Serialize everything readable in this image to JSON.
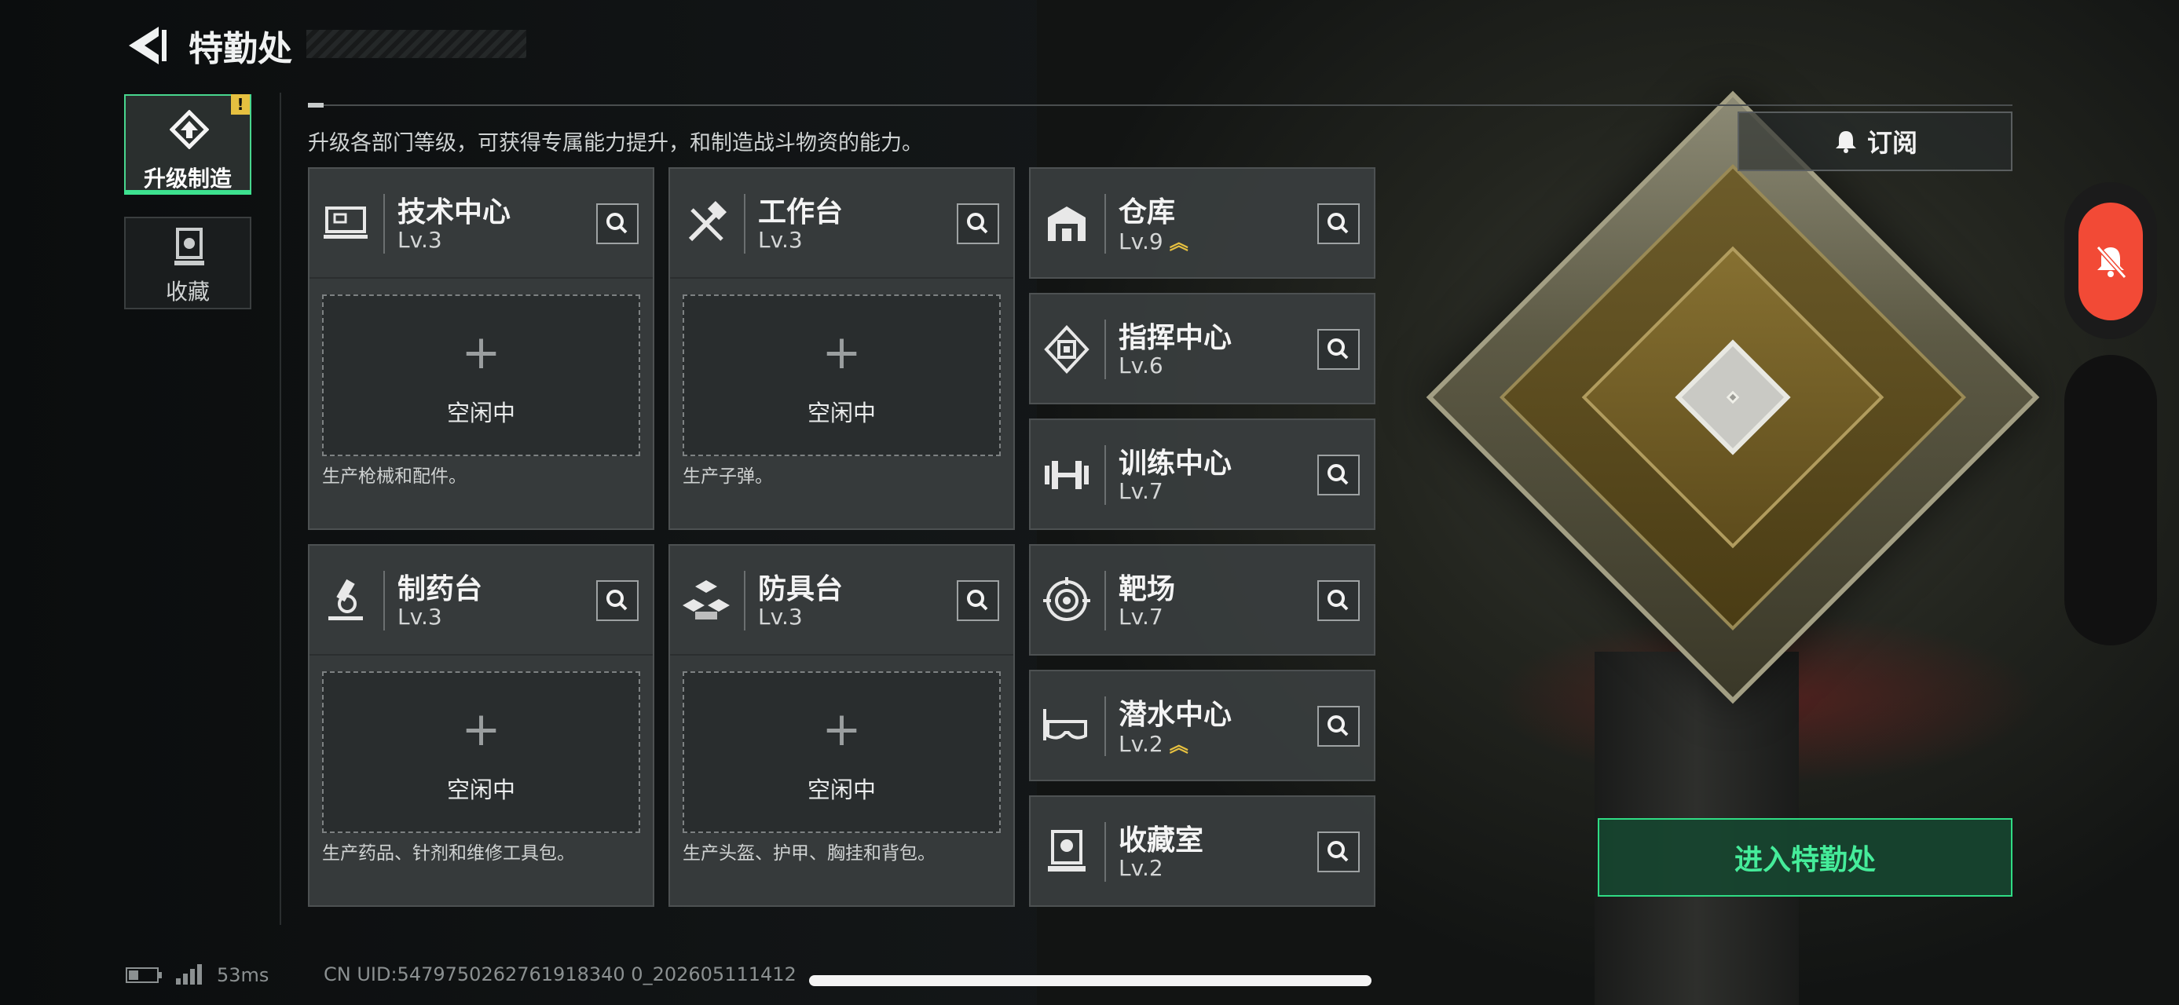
{
  "header": {
    "title": "特勤处",
    "back_icon": "back-arrow-icon"
  },
  "sidebar": {
    "items": [
      {
        "label": "升级制造",
        "icon": "upgrade-icon",
        "active": true,
        "badge": "!"
      },
      {
        "label": "收藏",
        "icon": "collection-icon",
        "active": false
      }
    ]
  },
  "main": {
    "description": "升级各部门等级，可获得专属能力提升，和制造战斗物资的能力。",
    "subscribe_label": "订阅",
    "production_cards": [
      {
        "name": "技术中心",
        "level": "Lv.3",
        "icon": "tech-center-icon",
        "slot": {
          "plus": "+",
          "status": "空闲中"
        },
        "desc": "生产枪械和配件。"
      },
      {
        "name": "工作台",
        "level": "Lv.3",
        "icon": "workbench-icon",
        "slot": {
          "plus": "+",
          "status": "空闲中"
        },
        "desc": "生产子弹。"
      },
      {
        "name": "制药台",
        "level": "Lv.3",
        "icon": "pharmacy-icon",
        "slot": {
          "plus": "+",
          "status": "空闲中"
        },
        "desc": "生产药品、针剂和维修工具包。"
      },
      {
        "name": "防具台",
        "level": "Lv.3",
        "icon": "armor-bench-icon",
        "slot": {
          "plus": "+",
          "status": "空闲中"
        },
        "desc": "生产头盔、护甲、胸挂和背包。"
      }
    ],
    "facilities": [
      {
        "name": "仓库",
        "level": "Lv.9",
        "upgradable": true,
        "up_mark": "︽",
        "icon": "warehouse-icon"
      },
      {
        "name": "指挥中心",
        "level": "Lv.6",
        "upgradable": false,
        "icon": "command-center-icon"
      },
      {
        "name": "训练中心",
        "level": "Lv.7",
        "upgradable": false,
        "icon": "dumbbell-icon"
      },
      {
        "name": "靶场",
        "level": "Lv.7",
        "upgradable": false,
        "icon": "target-icon"
      },
      {
        "name": "潜水中心",
        "level": "Lv.2",
        "upgradable": true,
        "up_mark": "︽",
        "icon": "diving-mask-icon"
      },
      {
        "name": "收藏室",
        "level": "Lv.2",
        "upgradable": false,
        "icon": "collection-room-icon"
      }
    ],
    "enter_label": "进入特勤处"
  },
  "status_bar": {
    "ping": "53ms",
    "uid": "CN UID:5479750262761918340 0_202605111412"
  },
  "colors": {
    "accent_green": "#3de18f",
    "badge_yellow": "#e6c040",
    "mute_red": "#f24a36"
  }
}
